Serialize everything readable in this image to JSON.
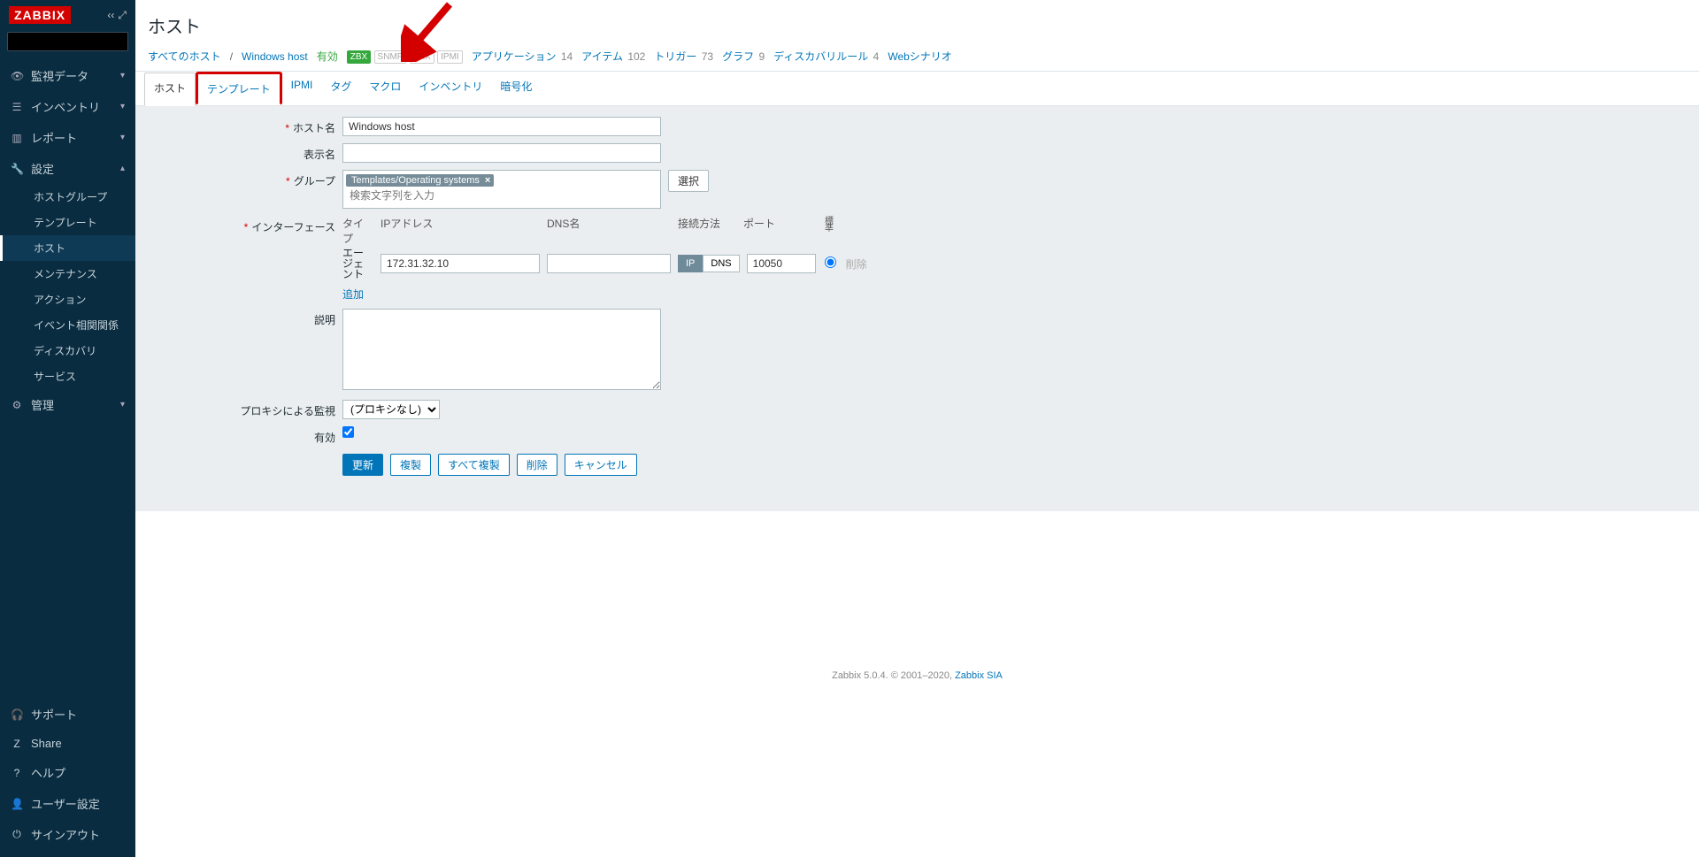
{
  "brand": "ZABBIX",
  "search": {
    "placeholder": ""
  },
  "nav": {
    "monitoring": "監視データ",
    "inventory": "インベントリ",
    "reports": "レポート",
    "config": "設定",
    "config_items": {
      "hostgroups": "ホストグループ",
      "templates": "テンプレート",
      "hosts": "ホスト",
      "maintenance": "メンテナンス",
      "actions": "アクション",
      "correlation": "イベント相関関係",
      "discovery": "ディスカバリ",
      "services": "サービス"
    },
    "admin": "管理"
  },
  "nav_bottom": {
    "support": "サポート",
    "share": "Share",
    "help": "ヘルプ",
    "profile": "ユーザー設定",
    "logout": "サインアウト"
  },
  "page": {
    "title": "ホスト",
    "crumb_all": "すべてのホスト",
    "crumb_host": "Windows host",
    "enabled": "有効",
    "badge_zbx": "ZBX",
    "badge_snmp": "SNMP",
    "badge_jmx": "JMX",
    "badge_ipmi": "IPMI",
    "nav_app": "アプリケーション",
    "nav_app_n": "14",
    "nav_item": "アイテム",
    "nav_item_n": "102",
    "nav_trig": "トリガー",
    "nav_trig_n": "73",
    "nav_graph": "グラフ",
    "nav_graph_n": "9",
    "nav_disc": "ディスカバリルール",
    "nav_disc_n": "4",
    "nav_web": "Webシナリオ"
  },
  "tabs": {
    "host": "ホスト",
    "templates": "テンプレート",
    "ipmi": "IPMI",
    "tags": "タグ",
    "macros": "マクロ",
    "inventory": "インベントリ",
    "encryption": "暗号化"
  },
  "form": {
    "hostname_label": "ホスト名",
    "hostname_value": "Windows host",
    "visiblename_label": "表示名",
    "visiblename_value": "",
    "groups_label": "グループ",
    "groups_chip": "Templates/Operating systems",
    "groups_placeholder": "検索文字列を入力",
    "groups_select_btn": "選択",
    "interfaces_label": "インターフェース",
    "if_head_type": "タイプ",
    "if_head_ip": "IPアドレス",
    "if_head_dns": "DNS名",
    "if_head_conn": "接続方法",
    "if_head_port": "ポート",
    "if_head_default": "標準",
    "if_agent_label": "エージェント",
    "if_ip_value": "172.31.32.10",
    "if_dns_value": "",
    "if_conn_ip": "IP",
    "if_conn_dns": "DNS",
    "if_port_value": "10050",
    "if_delete": "削除",
    "if_add": "追加",
    "description_label": "説明",
    "description_value": "",
    "proxy_label": "プロキシによる監視",
    "proxy_value": "(プロキシなし)",
    "enabled_label": "有効",
    "btn_update": "更新",
    "btn_clone": "複製",
    "btn_fullclone": "すべて複製",
    "btn_delete": "削除",
    "btn_cancel": "キャンセル"
  },
  "footer": {
    "text": "Zabbix 5.0.4. © 2001–2020, ",
    "link": "Zabbix SIA"
  }
}
